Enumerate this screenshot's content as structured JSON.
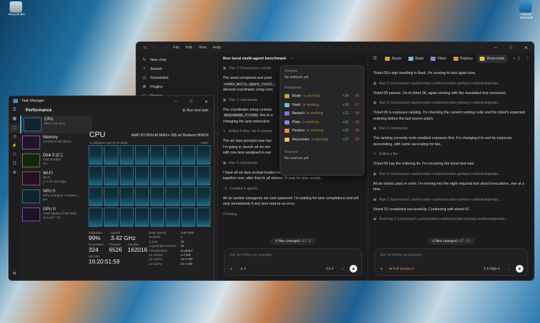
{
  "desktop": {
    "recycle_bin": "Recycle Bin",
    "top_right_icon": "Diverse\nMicrosoft"
  },
  "codex": {
    "menu": [
      "File",
      "Edit",
      "View",
      "Help"
    ],
    "sidebar": [
      {
        "icon": "new-chat-icon",
        "label": "New chat"
      },
      {
        "icon": "search-icon",
        "label": "Search"
      },
      {
        "icon": "clock-icon",
        "label": "Scheduled"
      },
      {
        "icon": "plugin-icon",
        "label": "Plugins"
      },
      {
        "icon": "folder-icon",
        "label": "Project"
      }
    ],
    "left": {
      "title": "Run local multi-agent benchmark",
      "ran1": "Ran C:\\Users\\user\\.cache\\",
      "p1a": "The seed completed and prod",
      "p1b": "codex_multi_agent_local_",
      "p1c": "allowed coordinator setup com",
      "ran2": "Ran 2 commands",
      "p2a": "The coordinator setup comma",
      "p2b": "BENCHMARK_PYTHON",
      "p2b2": " line to e",
      "p2c": "changing the lane instruction",
      "edited": "Edited 6 files, ran 6 comma",
      "p3a": "The six lane prompts now hav",
      "p3b": "I'm going to launch all six wor",
      "p3c": "with one lane assigned to eac",
      "ran6": "Ran 6 commands",
      "p4": "I have all six lane prompt bodies loaded. Launching the six real worker subagents together now; after they're all started, I'll wait for lane results.",
      "created": "Created 6 agents",
      "p5": "All six worker subagents are now spawned. I'm waiting for lane completions and will stop immediately if any lane returns an error.",
      "thinking": "Thinking",
      "files_changed": "6 files changed",
      "fc_add": "+12",
      "fc_del": "-6",
      "placeholder": "Ask for follow-up changes",
      "model": "5.5"
    },
    "right": {
      "tabs": [
        {
          "name": "Boyle",
          "color": "#c9a23a"
        },
        {
          "name": "Nash",
          "color": "#6ec0e0"
        },
        {
          "name": "Plato",
          "color": "#9c7be0"
        },
        {
          "name": "Pasteur",
          "color": "#d89040"
        },
        {
          "name": "Anscombe",
          "color": "#e0c050"
        }
      ],
      "m1": "Ticket 05's sign handling is fixed. I'm running its test again now.",
      "r1": "Ran C:\\Users\\user\\.cache\\codex-runtimes\\codex-primary-runtime\\depende...",
      "m2": "Ticket 05 passes. On to ticket 06, again starting with the mandated test command.",
      "r2": "Ran C:\\Users\\user\\.cache\\codex-runtimes\\codex-primary-runtime\\depende...",
      "m3": "Ticket 06 is exposure ranking. I'm checking the current ranking code and the ticket's expected ordering before the last source patch.",
      "r3": "Ran 3 commands",
      "m4": "The ranking currently sorts smallest exposure first. I'm changing it to sort by exposure descending, with name ascending for ties.",
      "r4": "Edited a file",
      "m5": "Ticket 06 has the ordering fix. I'm rerunning the ticket test now.",
      "r5": "Ran C:\\Users\\user\\.cache\\codex-runtimes\\codex-primary-runtime\\depende...",
      "m6": "All six tickets pass in order. I'm moving into the eight required tool shard invocations, one at a time.",
      "r6": "Ran C:\\Users\\user\\.cache\\codex-runtimes\\codex-primary-runtime\\depende...",
      "m7": "Shard 01 completed successfully. Continuing with shard 02.",
      "r7": "Running C:\\Users\\user\\.cache\\codex-runtimes\\codex-primary-runtime\\depende...",
      "files_changed": "6 files changed",
      "fc_add": "+27",
      "fc_del": "-24",
      "placeholder": "Ask for follow-up changes",
      "access": "Full access",
      "model": "5.5",
      "effort": "High"
    },
    "popover": {
      "outputs": "Outputs",
      "no_artifacts": "No artifacts yet",
      "subagents": "Subagents",
      "agents": [
        {
          "name": "Boyle",
          "status": "working",
          "add": "+24",
          "del": "-20",
          "color": "#c9a23a"
        },
        {
          "name": "Nash",
          "status": "working",
          "add": "+20",
          "del": "-17",
          "color": "#6ec0e0"
        },
        {
          "name": "Banach",
          "status": "working",
          "add": "+21",
          "del": "-18",
          "color": "#8a6fd8"
        },
        {
          "name": "Plato",
          "status": "working",
          "add": "+21",
          "del": "-18",
          "color": "#9c7be0"
        },
        {
          "name": "Pasteur",
          "status": "working",
          "add": "+23",
          "del": "-20",
          "color": "#d89040"
        },
        {
          "name": "Anscombe",
          "status": "working",
          "add": "+27",
          "del": "-24",
          "color": "#e0c050"
        }
      ],
      "is_label": "is",
      "sources": "Sources",
      "no_sources": "No sources yet"
    }
  },
  "taskmgr": {
    "title": "Task Manager",
    "section": "Performance",
    "run_task": "Run new task",
    "items": [
      {
        "name": "CPU",
        "sub": "99% 3.42 GHz"
      },
      {
        "name": "Memory",
        "sub": "16.6/63.6 GB (26%)"
      },
      {
        "name": "Disk 0 (C:)",
        "sub": "SSD (NVMe)\n3%"
      },
      {
        "name": "Wi-Fi",
        "sub": "Wi-Fi\nS: 0 R: 3.6 Kbps"
      },
      {
        "name": "NPU 0",
        "sub": "NPU Compute Accelera...\n0%"
      },
      {
        "name": "GPU 0",
        "sub": "AMD Radeon(TM) 8060\n21% (57 °C)"
      }
    ],
    "cpu_title": "CPU",
    "cpu_model": "AMD RYZEN AI MAX+ 395 w/ Radeon 8060S",
    "util_label": "% Utilization over 60 seconds",
    "util_max": "100%",
    "stats": [
      {
        "label": "Utilization",
        "value": "99%"
      },
      {
        "label": "Speed",
        "value": "3.42 GHz"
      },
      {
        "label": "Processes",
        "value": "324"
      },
      {
        "label": "Threads",
        "value": "6526"
      },
      {
        "label": "Handles",
        "value": "162016"
      }
    ],
    "uptime_label": "Up time",
    "uptime": "16:20:51:59",
    "specs": [
      [
        "Base speed:",
        "3.00 GHz"
      ],
      [
        "Sockets:",
        "1"
      ],
      [
        "Cores:",
        "16"
      ],
      [
        "Logical processors:",
        "32"
      ],
      [
        "Virtualization:",
        "Enabled"
      ],
      [
        "L1 cache:",
        "1.2 MB"
      ],
      [
        "L2 cache:",
        "16.0 MB"
      ],
      [
        "L3 cache:",
        "64.0 MB"
      ]
    ]
  }
}
